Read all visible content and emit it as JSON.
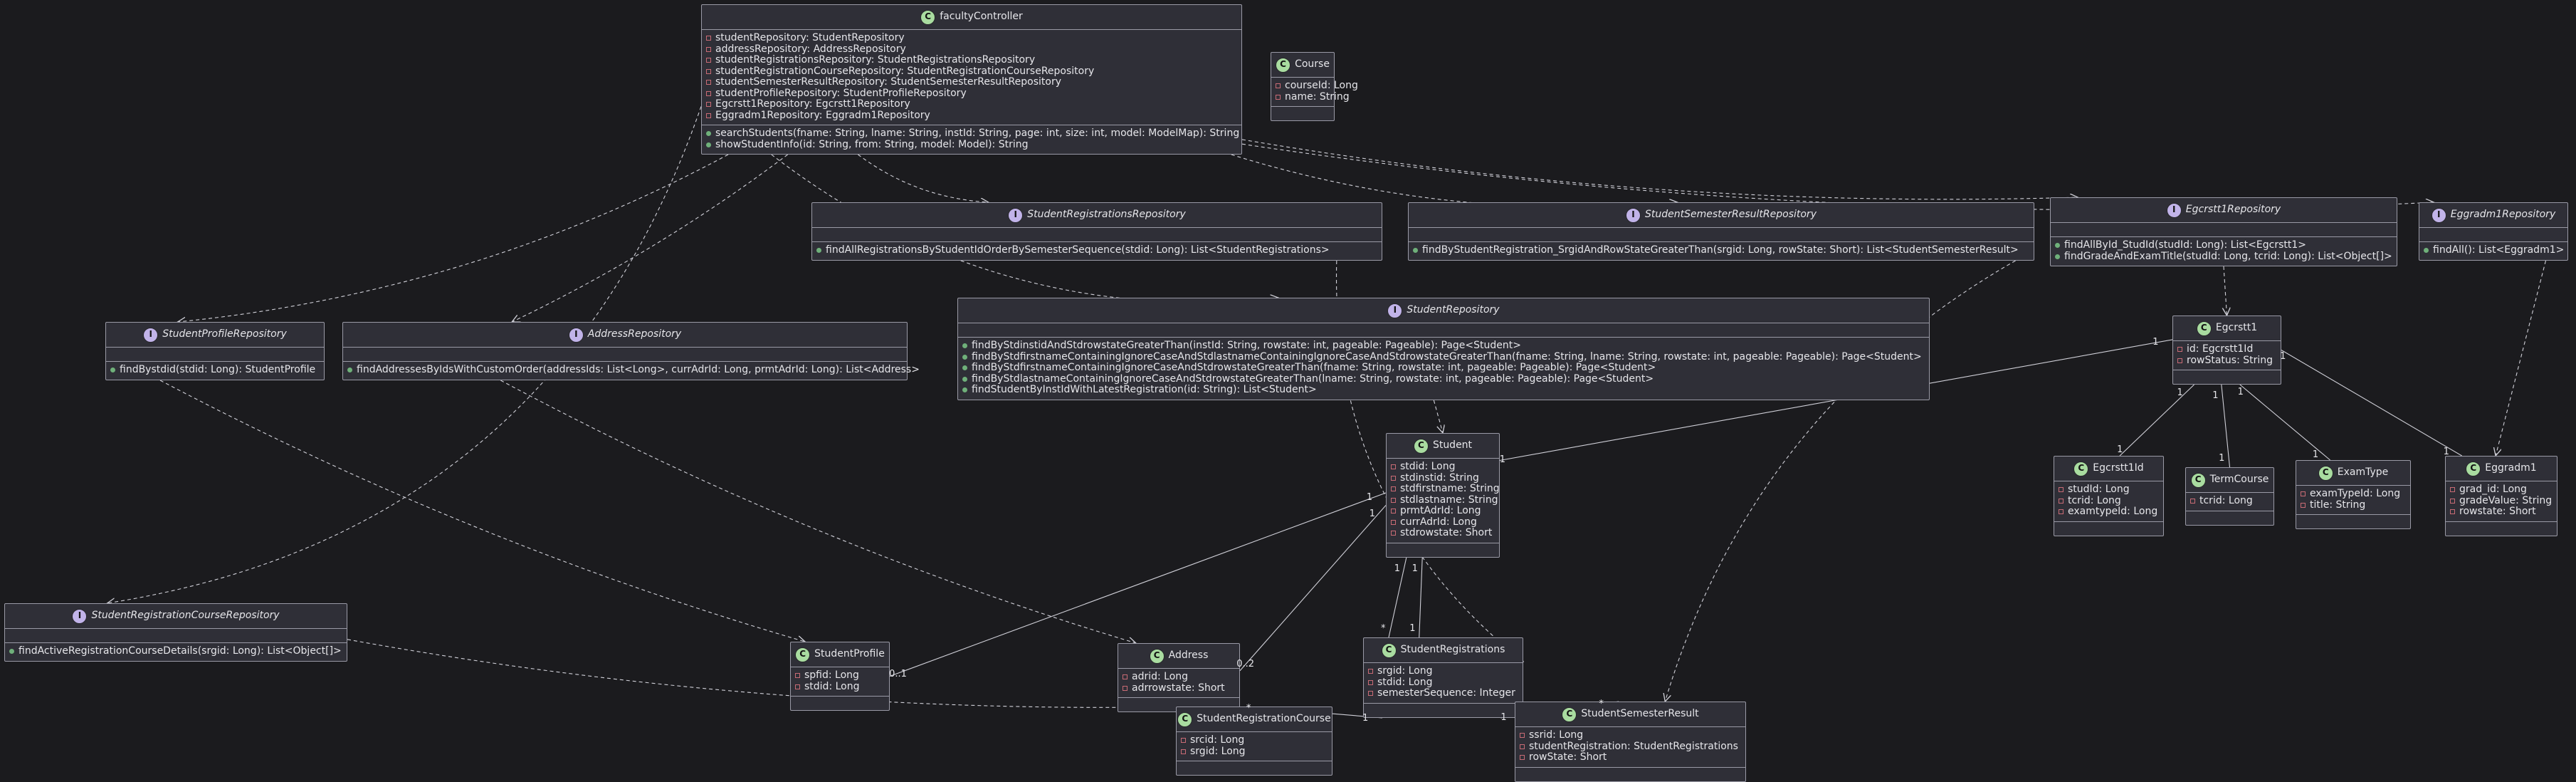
{
  "classes": {
    "facultyController": {
      "name": "facultyController",
      "kind": "class",
      "fields": [
        "studentRepository: StudentRepository",
        "addressRepository: AddressRepository",
        "studentRegistrationsRepository: StudentRegistrationsRepository",
        "studentRegistrationCourseRepository: StudentRegistrationCourseRepository",
        "studentSemesterResultRepository: StudentSemesterResultRepository",
        "studentProfileRepository: StudentProfileRepository",
        "Egcrstt1Repository: Egcrstt1Repository",
        "Eggradm1Repository: Eggradm1Repository"
      ],
      "methods": [
        "searchStudents(fname: String, lname: String, instId: String, page: int, size: int, model: ModelMap): String",
        "showStudentInfo(id: String, from: String, model: Model): String"
      ]
    },
    "course": {
      "name": "Course",
      "kind": "class",
      "fields": [
        "courseId: Long",
        "name: String"
      ],
      "methods": []
    },
    "studentRegistrationsRepository": {
      "name": "StudentRegistrationsRepository",
      "kind": "interface",
      "fields": [],
      "methods": [
        "findAllRegistrationsByStudentIdOrderBySemesterSequence(stdid: Long): List<StudentRegistrations>"
      ]
    },
    "studentSemesterResultRepository": {
      "name": "StudentSemesterResultRepository",
      "kind": "interface",
      "fields": [],
      "methods": [
        "findByStudentRegistration_SrgidAndRowStateGreaterThan(srgid: Long, rowState: Short): List<StudentSemesterResult>"
      ]
    },
    "egcrstt1Repository": {
      "name": "Egcrstt1Repository",
      "kind": "interface",
      "fields": [],
      "methods": [
        "findAllById_StudId(studId: Long): List<Egcrstt1>",
        "findGradeAndExamTitle(studId: Long, tcrid: Long): List<Object[]>"
      ]
    },
    "eggradm1Repository": {
      "name": "Eggradm1Repository",
      "kind": "interface",
      "fields": [],
      "methods": [
        "findAll(): List<Eggradm1>"
      ]
    },
    "studentProfileRepository": {
      "name": "StudentProfileRepository",
      "kind": "interface",
      "fields": [],
      "methods": [
        "findBystdid(stdid: Long): StudentProfile"
      ]
    },
    "addressRepository": {
      "name": "AddressRepository",
      "kind": "interface",
      "fields": [],
      "methods": [
        "findAddressesByIdsWithCustomOrder(addressIds: List<Long>, currAdrId: Long, prmtAdrId: Long): List<Address>"
      ]
    },
    "studentRepository": {
      "name": "StudentRepository",
      "kind": "interface",
      "fields": [],
      "methods": [
        "findByStdinstidAndStdrowstateGreaterThan(instId: String, rowstate: int, pageable: Pageable): Page<Student>",
        "findByStdfirstnameContainingIgnoreCaseAndStdlastnameContainingIgnoreCaseAndStdrowstateGreaterThan(fname: String, lname: String, rowstate: int, pageable: Pageable): Page<Student>",
        "findByStdfirstnameContainingIgnoreCaseAndStdrowstateGreaterThan(fname: String, rowstate: int, pageable: Pageable): Page<Student>",
        "findByStdlastnameContainingIgnoreCaseAndStdrowstateGreaterThan(lname: String, rowstate: int, pageable: Pageable): Page<Student>",
        "findStudentByInstIdWithLatestRegistration(id: String): List<Student>"
      ]
    },
    "egcrstt1": {
      "name": "Egcrstt1",
      "kind": "class",
      "fields": [
        "id: Egcrstt1Id",
        "rowStatus: String"
      ],
      "methods": []
    },
    "student": {
      "name": "Student",
      "kind": "class",
      "fields": [
        "stdid: Long",
        "stdinstid: String",
        "stdfirstname: String",
        "stdlastname: String",
        "prmtAdrId: Long",
        "currAdrId: Long",
        "stdrowstate: Short"
      ],
      "methods": []
    },
    "egcrstt1Id": {
      "name": "Egcrstt1Id",
      "kind": "class",
      "fields": [
        "studId: Long",
        "tcrid: Long",
        "examtypeId: Long"
      ],
      "methods": []
    },
    "termCourse": {
      "name": "TermCourse",
      "kind": "class",
      "fields": [
        "tcrid: Long"
      ],
      "methods": []
    },
    "examType": {
      "name": "ExamType",
      "kind": "class",
      "fields": [
        "examTypeId: Long",
        "title: String"
      ],
      "methods": []
    },
    "eggradm1": {
      "name": "Eggradm1",
      "kind": "class",
      "fields": [
        "grad_id: Long",
        "gradeValue: String",
        "rowstate: Short"
      ],
      "methods": []
    },
    "studentRegistrationCourseRepository": {
      "name": "StudentRegistrationCourseRepository",
      "kind": "interface",
      "fields": [],
      "methods": [
        "findActiveRegistrationCourseDetails(srgid: Long): List<Object[]>"
      ]
    },
    "studentProfile": {
      "name": "StudentProfile",
      "kind": "class",
      "fields": [
        "spfid: Long",
        "stdid: Long"
      ],
      "methods": []
    },
    "address": {
      "name": "Address",
      "kind": "class",
      "fields": [
        "adrid: Long",
        "adrrowstate: Short"
      ],
      "methods": []
    },
    "studentRegistrations": {
      "name": "StudentRegistrations",
      "kind": "class",
      "fields": [
        "srgid: Long",
        "stdid: Long",
        "semesterSequence: Integer"
      ],
      "methods": []
    },
    "studentRegistrationCourse": {
      "name": "StudentRegistrationCourse",
      "kind": "class",
      "fields": [
        "srcid: Long",
        "srgid: Long"
      ],
      "methods": []
    },
    "studentSemesterResult": {
      "name": "StudentSemesterResult",
      "kind": "class",
      "fields": [
        "ssrid: Long",
        "studentRegistration: StudentRegistrations",
        "rowState: Short"
      ],
      "methods": []
    }
  },
  "relations": [
    {
      "from": "facultyController",
      "to": "studentRegistrationsRepository",
      "type": "dependency"
    },
    {
      "from": "facultyController",
      "to": "studentSemesterResultRepository",
      "type": "dependency"
    },
    {
      "from": "facultyController",
      "to": "egcrstt1Repository",
      "type": "dependency"
    },
    {
      "from": "facultyController",
      "to": "eggradm1Repository",
      "type": "dependency"
    },
    {
      "from": "facultyController",
      "to": "studentProfileRepository",
      "type": "dependency"
    },
    {
      "from": "facultyController",
      "to": "addressRepository",
      "type": "dependency"
    },
    {
      "from": "facultyController",
      "to": "studentRepository",
      "type": "dependency"
    },
    {
      "from": "facultyController",
      "to": "studentRegistrationCourseRepository",
      "type": "dependency"
    },
    {
      "from": "studentRepository",
      "to": "student",
      "type": "dependency"
    },
    {
      "from": "studentProfileRepository",
      "to": "studentProfile",
      "type": "dependency"
    },
    {
      "from": "addressRepository",
      "to": "address",
      "type": "dependency"
    },
    {
      "from": "studentRegistrationsRepository",
      "to": "studentRegistrations",
      "type": "dependency"
    },
    {
      "from": "studentSemesterResultRepository",
      "to": "studentSemesterResult",
      "type": "dependency"
    },
    {
      "from": "egcrstt1Repository",
      "to": "egcrstt1",
      "type": "dependency"
    },
    {
      "from": "eggradm1Repository",
      "to": "eggradm1",
      "type": "dependency"
    },
    {
      "from": "studentRegistrationCourseRepository",
      "to": "studentRegistrationCourse",
      "type": "dependency"
    },
    {
      "from": "egcrstt1",
      "to": "student",
      "type": "association",
      "fromMult": "1",
      "toMult": "1"
    },
    {
      "from": "egcrstt1",
      "to": "egcrstt1Id",
      "type": "association",
      "fromMult": "1",
      "toMult": "1"
    },
    {
      "from": "egcrstt1",
      "to": "termCourse",
      "type": "association",
      "fromMult": "1",
      "toMult": "1"
    },
    {
      "from": "egcrstt1",
      "to": "examType",
      "type": "association",
      "fromMult": "1",
      "toMult": "1"
    },
    {
      "from": "egcrstt1",
      "to": "eggradm1",
      "type": "association",
      "fromMult": "1",
      "toMult": "1"
    },
    {
      "from": "student",
      "to": "studentProfile",
      "type": "association",
      "fromMult": "1",
      "toMult": "0..1"
    },
    {
      "from": "student",
      "to": "address",
      "type": "association",
      "fromMult": "1",
      "toMult": "0..2"
    },
    {
      "from": "student",
      "to": "studentRegistrations",
      "type": "association",
      "fromMult": "1",
      "toMult": "*"
    },
    {
      "from": "student",
      "to": "studentRegistrations",
      "type": "association",
      "fromMult": "1",
      "toMult": "1"
    },
    {
      "from": "studentRegistrations",
      "to": "studentRegistrationCourse",
      "type": "association",
      "fromMult": "1",
      "toMult": "*"
    },
    {
      "from": "studentRegistrations",
      "to": "studentSemesterResult",
      "type": "association",
      "fromMult": "1",
      "toMult": "*"
    }
  ]
}
